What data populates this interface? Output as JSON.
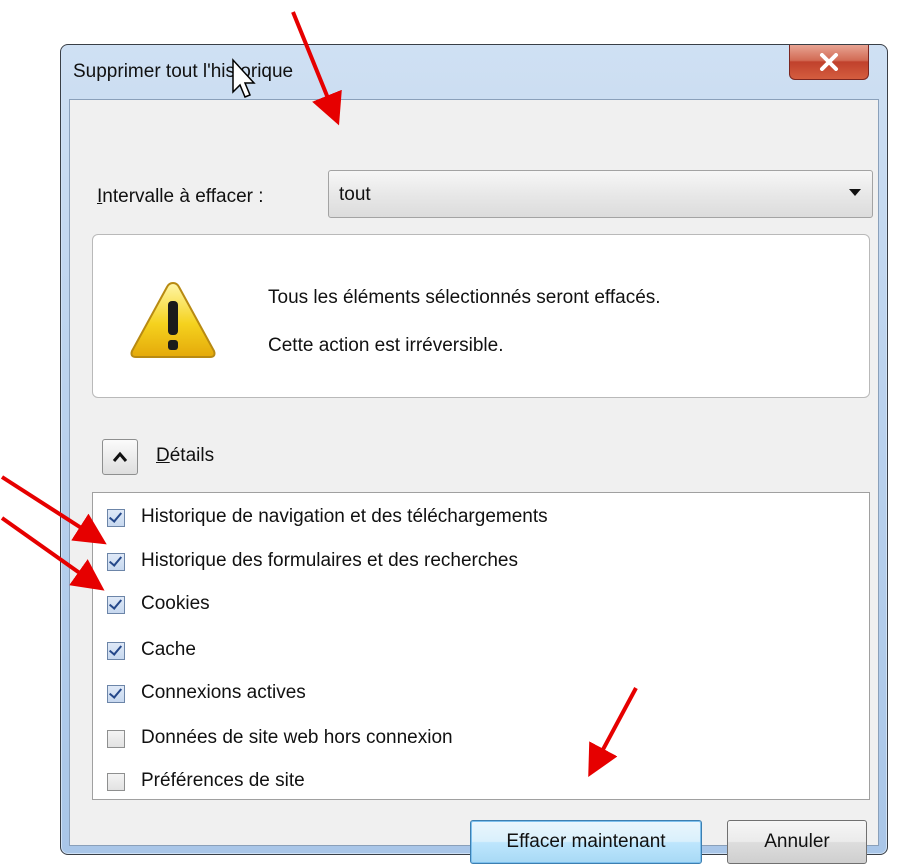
{
  "dialog": {
    "title": "Supprimer tout l'historique",
    "close_icon": "close-icon"
  },
  "range": {
    "label_access_key": "I",
    "label_rest": "ntervalle à effacer :",
    "selected_value": "tout"
  },
  "warning": {
    "icon": "warning-icon",
    "line1": "Tous les éléments sélectionnés seront effacés.",
    "line2": "Cette action est irréversible."
  },
  "details": {
    "toggle_icon": "chevron-up-icon",
    "label_access_key": "D",
    "label_rest": "étails",
    "items": [
      {
        "label": "Historique de navigation et des téléchargements",
        "checked": true
      },
      {
        "label": "Historique des formulaires et des recherches",
        "checked": true
      },
      {
        "label": "Cookies",
        "checked": true
      },
      {
        "label": "Cache",
        "checked": true
      },
      {
        "label": "Connexions actives",
        "checked": true
      },
      {
        "label": "Données de site web hors connexion",
        "checked": false
      },
      {
        "label": "Préférences de site",
        "checked": false
      }
    ]
  },
  "buttons": {
    "clear_now": "Effacer maintenant",
    "cancel": "Annuler"
  },
  "annotations": {
    "arrow_color": "#e60000"
  }
}
